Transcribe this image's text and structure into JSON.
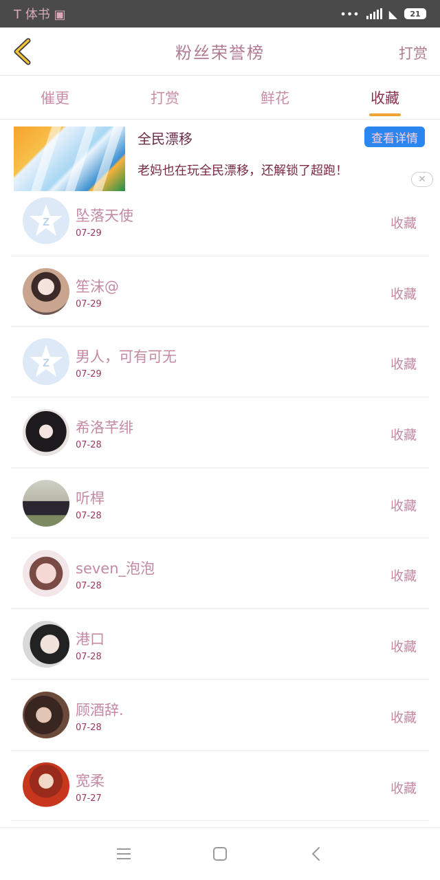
{
  "status_bar": {
    "left_text": "T 体书 ▣",
    "dots": "•••",
    "battery": "21"
  },
  "header": {
    "title": "粉丝荣誉榜",
    "action": "打赏"
  },
  "tabs": [
    {
      "label": "催更",
      "active": false
    },
    {
      "label": "打赏",
      "active": false
    },
    {
      "label": "鲜花",
      "active": false
    },
    {
      "label": "收藏",
      "active": true
    }
  ],
  "ad": {
    "title": "全民漂移",
    "description": "老妈也在玩全民漂移，还解锁了超跑！",
    "button": "查看详情",
    "close": "✕"
  },
  "users": [
    {
      "name": "坠落天使",
      "date": "07-29",
      "action": "收藏",
      "avatar": "default"
    },
    {
      "name": "笙沫@",
      "date": "07-29",
      "action": "收藏",
      "avatar": "photo"
    },
    {
      "name": "男人，可有可无",
      "date": "07-29",
      "action": "收藏",
      "avatar": "default"
    },
    {
      "name": "希洛芊绯",
      "date": "07-28",
      "action": "收藏",
      "avatar": "photo"
    },
    {
      "name": "听桿",
      "date": "07-28",
      "action": "收藏",
      "avatar": "photo"
    },
    {
      "name": "seven_泡泡",
      "date": "07-28",
      "action": "收藏",
      "avatar": "photo"
    },
    {
      "name": "港口",
      "date": "07-28",
      "action": "收藏",
      "avatar": "photo"
    },
    {
      "name": "顾酒辞.",
      "date": "07-28",
      "action": "收藏",
      "avatar": "photo"
    },
    {
      "name": "宽柔",
      "date": "07-27",
      "action": "收藏",
      "avatar": "photo"
    }
  ],
  "colors": {
    "accent": "#f0a22e",
    "text_pink": "#c48aa2",
    "ad_button": "#2c86f0",
    "back_arrow": "#f2c23a"
  }
}
